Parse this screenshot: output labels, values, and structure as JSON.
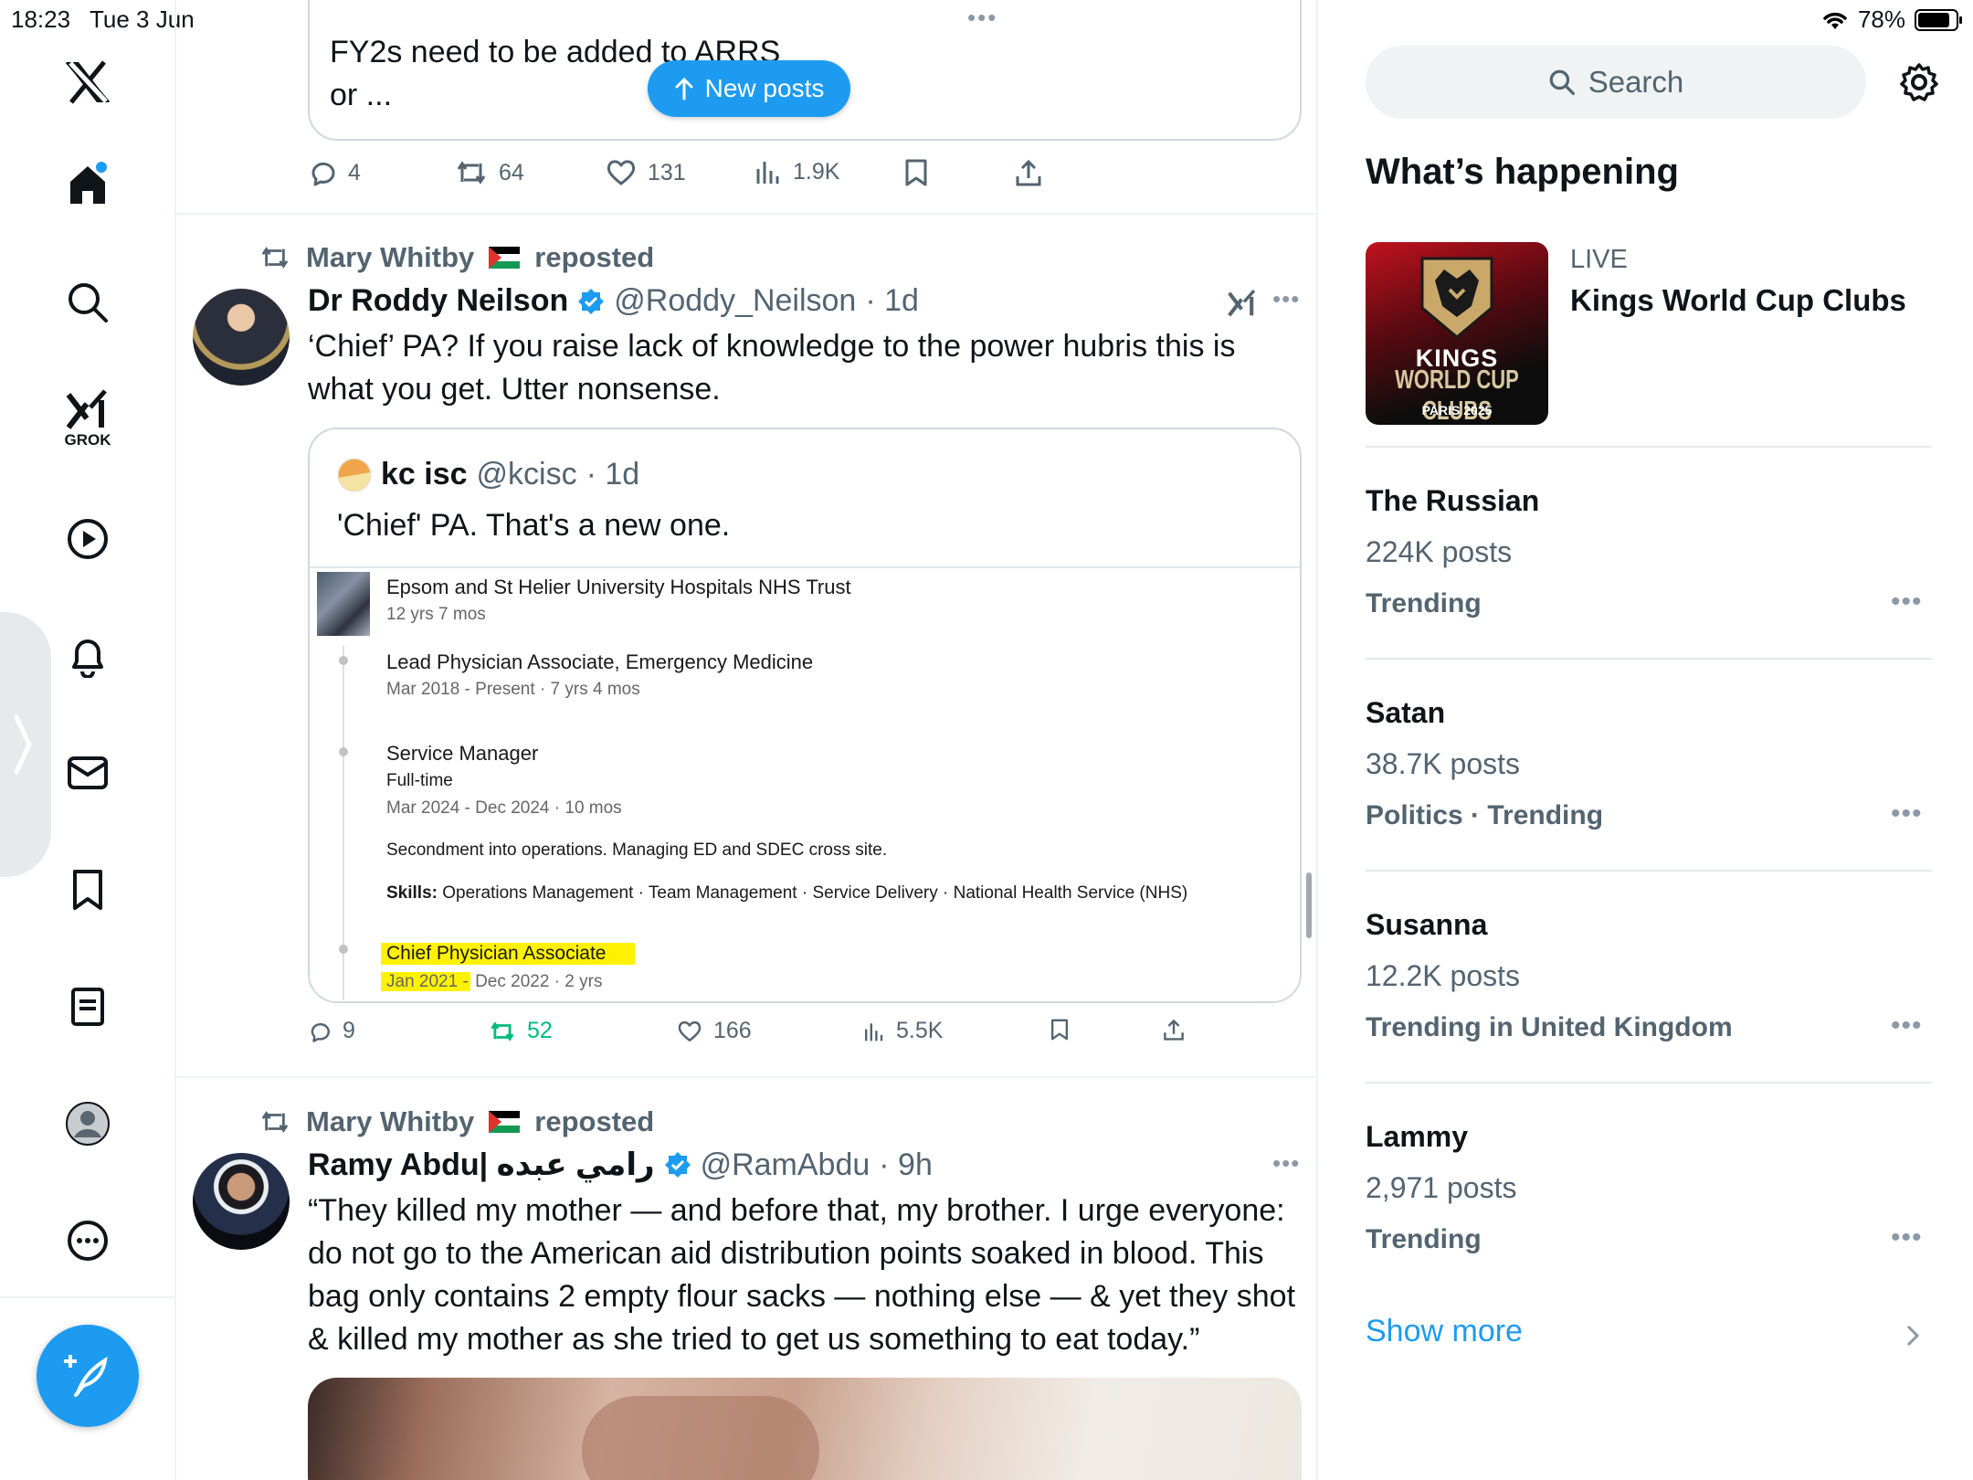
{
  "status_bar": {
    "time": "18:23",
    "date": "Tue 3 Jun",
    "battery": "78%"
  },
  "nav": {
    "grok_label": "GROK"
  },
  "feed": {
    "top_tweet": {
      "text_line1": "FY2s need to be added to ARRS",
      "text_line2": "or ...",
      "replies": "4",
      "reposts": "64",
      "likes": "131",
      "views": "1.9K",
      "menu": "•••"
    },
    "new_posts_label": "New posts",
    "tweet1": {
      "repost_by": "Mary Whitby",
      "repost_suffix": "reposted",
      "author_name": "Dr Roddy Neilson",
      "author_handle": "@Roddy_Neilson",
      "age": "· 1d",
      "text": "‘Chief’ PA? If you raise lack of knowledge to the power hubris this is what you get. Utter nonsense.",
      "quote": {
        "author_name": "kc isc",
        "author_handle": "@kcisc",
        "age": "· 1d",
        "text": "'Chief' PA. That's a new one.",
        "screenshot": {
          "org": "Epsom and St Helier University Hospitals NHS Trust",
          "org_tenure": "12 yrs 7 mos",
          "role1_title": "Lead Physician Associate, Emergency Medicine",
          "role1_dates": "Mar 2018 - Present · 7 yrs 4 mos",
          "role2_title": "Service Manager",
          "role2_type": "Full-time",
          "role2_dates": "Mar 2024 - Dec 2024 · 10 mos",
          "role2_desc": "Secondment into operations. Managing ED and SDEC cross site.",
          "role2_skills_label": "Skills:",
          "role2_skills": "Operations Management · Team Management · Service Delivery · National Health Service (NHS)",
          "role3_title": "Chief Physician Associate",
          "role3_dates_highlight": "Jan 2021 -",
          "role3_dates_rest": "Dec 2022 · 2 yrs"
        }
      },
      "replies": "9",
      "reposts": "52",
      "likes": "166",
      "views": "5.5K"
    },
    "tweet2": {
      "repost_by": "Mary Whitby",
      "repost_suffix": "reposted",
      "author_name": "Ramy Abdu| رامي عبده",
      "author_handle": "@RamAbdu",
      "age": "· 9h",
      "text": "“They killed my mother — and before that, my brother. I urge everyone: do not go to the American aid distribution points soaked in blood. This bag only contains 2 empty flour sacks — nothing else — & yet they shot & killed my mother as she tried to get us something to eat today.”"
    }
  },
  "sidebar": {
    "search_placeholder": "Search",
    "heading": "What’s happening",
    "live": {
      "label": "LIVE",
      "title": "Kings World Cup Clubs",
      "logo_line1": "KINGS",
      "logo_line2": "WORLD CUP CLUBS",
      "logo_line3": "PARIS 2025"
    },
    "trends": [
      {
        "title": "The Russian",
        "posts": "224K posts",
        "category": "Trending"
      },
      {
        "title": "Satan",
        "posts": "38.7K posts",
        "category": "Politics · Trending"
      },
      {
        "title": "Susanna",
        "posts": "12.2K posts",
        "category": "Trending in United Kingdom"
      },
      {
        "title": "Lammy",
        "posts": "2,971 posts",
        "category": "Trending"
      }
    ],
    "show_more": "Show more",
    "more_menu": "•••"
  },
  "colors": {
    "accent": "#1d9bf0",
    "repost_green": "#00ba7c",
    "secondary_text": "#536471"
  },
  "icons": [
    "x-logo-icon",
    "home-icon",
    "search-icon",
    "grok-icon",
    "video-icon",
    "notifications-icon",
    "messages-icon",
    "bookmarks-icon",
    "lists-icon",
    "profile-icon",
    "more-icon",
    "compose-icon",
    "settings-icon",
    "reply-icon",
    "repost-icon",
    "like-icon",
    "views-icon",
    "bookmark-icon",
    "share-icon",
    "verified-icon",
    "chevron-right-icon"
  ]
}
